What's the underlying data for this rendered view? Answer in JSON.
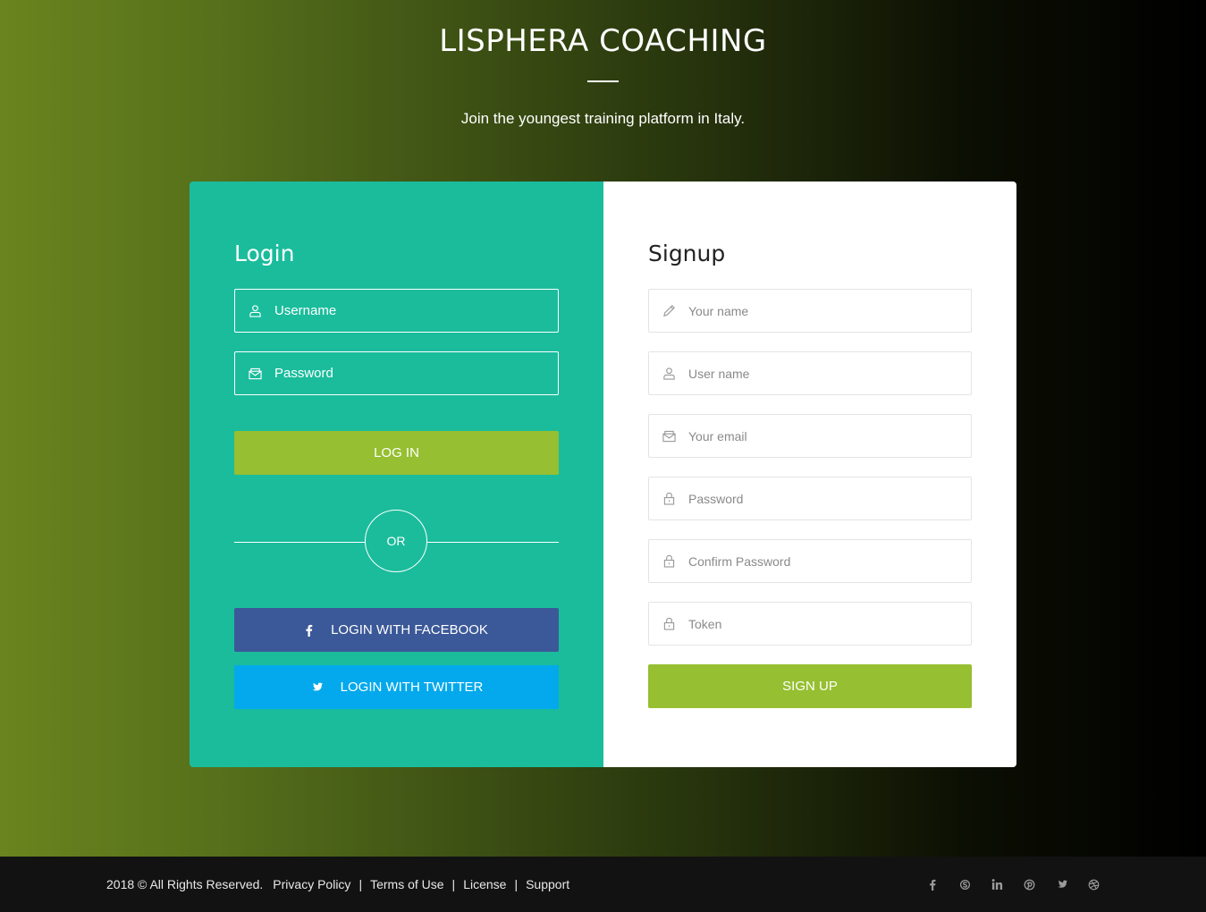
{
  "header": {
    "title": "LISPHERA COACHING",
    "tagline": "Join the youngest training platform in Italy."
  },
  "login": {
    "title": "Login",
    "username_placeholder": "Username",
    "password_placeholder": "Password",
    "login_button": "LOG IN",
    "or_label": "OR",
    "facebook_button": "LOGIN WITH FACEBOOK",
    "twitter_button": "LOGIN WITH TWITTER"
  },
  "signup": {
    "title": "Signup",
    "fields": [
      {
        "placeholder": "Your name",
        "icon": "pencil-icon"
      },
      {
        "placeholder": "User name",
        "icon": "user-icon"
      },
      {
        "placeholder": "Your email",
        "icon": "envelope-icon"
      },
      {
        "placeholder": "Password",
        "icon": "lock-icon"
      },
      {
        "placeholder": "Confirm Password",
        "icon": "lock-icon"
      },
      {
        "placeholder": "Token",
        "icon": "lock-icon"
      }
    ],
    "signup_button": "SIGN UP"
  },
  "footer": {
    "copyright": "2018 © All Rights Reserved.",
    "links": [
      "Privacy Policy",
      "Terms of Use",
      "License",
      "Support"
    ],
    "separator": "|",
    "social": [
      "facebook-icon",
      "skype-icon",
      "linkedin-icon",
      "pinterest-icon",
      "twitter-icon",
      "dribbble-icon"
    ]
  },
  "colors": {
    "login_panel": "#1abc9c",
    "accent_green": "#96bf31",
    "facebook": "#3b5998",
    "twitter": "#03a9ec",
    "footer_bg": "#121212"
  }
}
